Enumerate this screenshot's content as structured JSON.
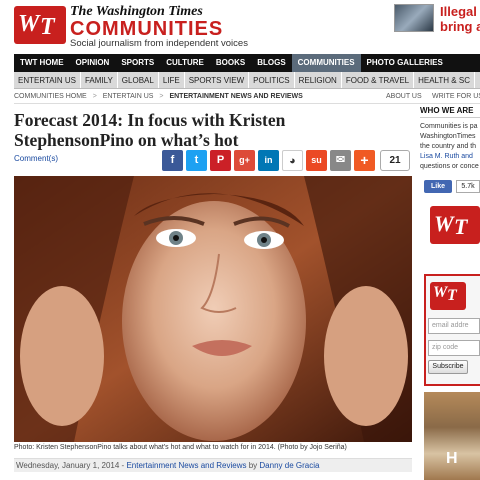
{
  "header": {
    "brand_top": "The Washington Times",
    "brand_main": "COMMUNITIES",
    "tagline": "Social journalism from independent voices",
    "logo_letters": [
      "W",
      "T"
    ],
    "ad_text": [
      "Illegal i",
      "bring a"
    ]
  },
  "nav_primary": [
    {
      "label": "TWT HOME",
      "active": false
    },
    {
      "label": "OPINION",
      "active": false
    },
    {
      "label": "SPORTS",
      "active": false
    },
    {
      "label": "CULTURE",
      "active": false
    },
    {
      "label": "BOOKS",
      "active": false
    },
    {
      "label": "BLOGS",
      "active": false
    },
    {
      "label": "COMMUNITIES",
      "active": true
    },
    {
      "label": "PHOTO GALLERIES",
      "active": false
    }
  ],
  "nav_secondary": [
    "ENTERTAIN US",
    "FAMILY",
    "GLOBAL",
    "LIFE",
    "SPORTS VIEW",
    "POLITICS",
    "RELIGION",
    "FOOD & TRAVEL",
    "HEALTH & SC"
  ],
  "breadcrumb": {
    "items": [
      "COMMUNITIES HOME",
      "ENTERTAIN US",
      "ENTERTAINMENT NEWS AND REVIEWS"
    ],
    "separator": ">",
    "right_links": [
      "ABOUT US",
      "WRITE FOR US"
    ]
  },
  "article": {
    "title_line1": "Forecast 2014: In focus with Kristen",
    "title_line2": "StephensonPino on what’s hot",
    "comments_label": "Comment(s)",
    "share_count": "21",
    "caption": "Photo: Kristen StephensonPino talks about what's hot and what to watch for in 2014. (Photo by Jojo Seriña)",
    "byline_date": "Wednesday, January 1, 2014 - ",
    "byline_section": "Entertainment News and Reviews",
    "byline_by": " by ",
    "byline_author": "Danny de Gracia"
  },
  "share_buttons": [
    {
      "icon": "facebook-icon",
      "glyph": "f",
      "color": "#3b5998"
    },
    {
      "icon": "twitter-icon",
      "glyph": "t",
      "color": "#1da1f2"
    },
    {
      "icon": "pinterest-icon",
      "glyph": "P",
      "color": "#cb2027"
    },
    {
      "icon": "googleplus-icon",
      "glyph": "g+",
      "color": "#dd4b39"
    },
    {
      "icon": "linkedin-icon",
      "glyph": "in",
      "color": "#0077b5"
    },
    {
      "icon": "reddit-icon",
      "glyph": "◕",
      "color": "#ffffff"
    },
    {
      "icon": "stumbleupon-icon",
      "glyph": "su",
      "color": "#eb4924"
    },
    {
      "icon": "email-icon",
      "glyph": "✉",
      "color": "#888888"
    },
    {
      "icon": "more-icon",
      "glyph": "+",
      "color": "#f05a24"
    }
  ],
  "sidebar": {
    "heading": "WHO WE ARE",
    "text_lines": [
      "Communities is pa",
      "WashingtonTimes",
      "the country and th",
      "Lisa M. Ruth and",
      "questions or conce"
    ],
    "fb_like": "Like",
    "fb_count": "5.7k",
    "email_placeholder": "email addre",
    "zip_placeholder": "zip code",
    "subscribe_label": "Subscribe",
    "ad_text": "H"
  }
}
